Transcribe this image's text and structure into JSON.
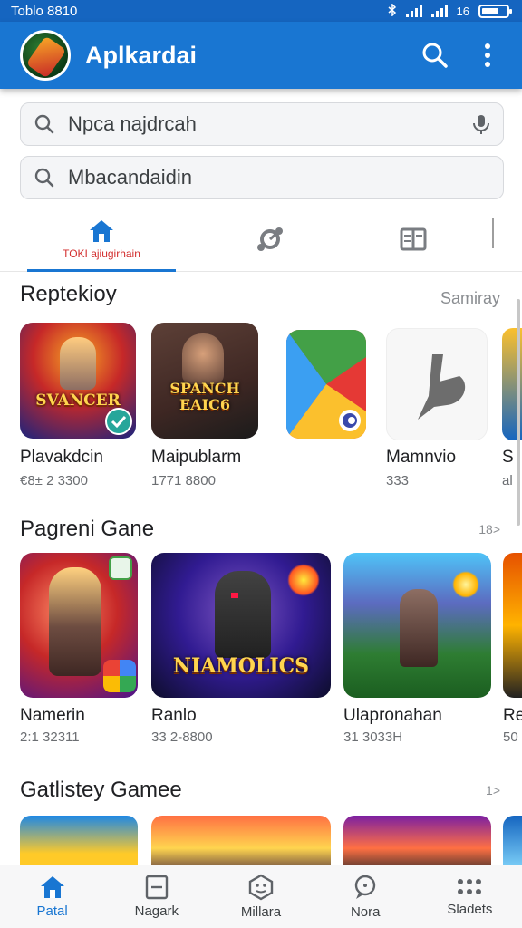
{
  "status_bar": {
    "time": "Toblo 8810",
    "network": "16"
  },
  "app_bar": {
    "title": "Aplkardai",
    "avatar_icon": "game-avatar-icon",
    "search_icon": "search-icon",
    "menu_icon": "more-vert-icon"
  },
  "search": [
    {
      "placeholder": "Npca najdrcah",
      "icon": "search-icon",
      "trailing_icon": "mic-icon"
    },
    {
      "placeholder": "Mbacandaidin",
      "icon": "search-icon"
    }
  ],
  "tabs": {
    "home_label": "TOKI ajiugirhain",
    "items": [
      {
        "icon": "home-icon"
      },
      {
        "icon": "settings-cog-icon"
      },
      {
        "icon": "library-icon"
      }
    ]
  },
  "sections": [
    {
      "title": "Reptekioy",
      "link": "Samiray",
      "items": [
        {
          "name": "Plavakdcin",
          "meta": "€8± 2 3300",
          "art_text": "SVANCER"
        },
        {
          "name": "Maipublarm",
          "meta": "1771 8800",
          "art_text": "SPANCH EAIC6"
        },
        {
          "name": "",
          "meta": ""
        },
        {
          "name": "Mamnvio",
          "meta": "333"
        },
        {
          "name": "S",
          "meta": "al"
        }
      ]
    },
    {
      "title": "Pagreni Gane",
      "link": "18>",
      "items": [
        {
          "name": "Namerin",
          "meta": "2:1 32311"
        },
        {
          "name": "Ranlo",
          "meta": "33 2-8800",
          "art_text": "NIAMOLICS"
        },
        {
          "name": "Ulapronahan",
          "meta": "31 3033H"
        },
        {
          "name": "Re",
          "meta": "50"
        }
      ]
    },
    {
      "title": "Gatlistey Gamee",
      "link": "1>"
    }
  ],
  "bottom_nav": [
    {
      "label": "Patal",
      "icon": "home-icon",
      "active": true
    },
    {
      "label": "Nagark",
      "icon": "bookmark-box-icon",
      "active": false
    },
    {
      "label": "Millara",
      "icon": "game-controller-icon",
      "active": false
    },
    {
      "label": "Nora",
      "icon": "chat-bubble-icon",
      "active": false
    },
    {
      "label": "Sladets",
      "icon": "apps-dots-icon",
      "active": false
    }
  ],
  "colors": {
    "primary": "#1976d2",
    "status_bar": "#1565c0",
    "accent_red": "#d32f2f"
  }
}
